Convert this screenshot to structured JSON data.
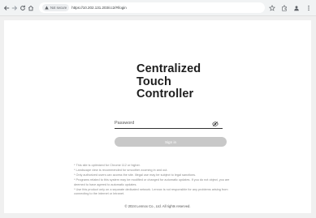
{
  "browser": {
    "security_label": "Not secure",
    "url": "https://10.202.131.203/cc2/#/login"
  },
  "login": {
    "title_lines": [
      "Centralized",
      "Touch",
      "Controller"
    ],
    "password_placeholder": "Password",
    "sign_in_label": "Sign in"
  },
  "notes": [
    "* This site is optimized for Chrome 112 or higher.",
    "* Landscape view is recommended for smoother zooming in and out.",
    "* Only authorized users can access the site. Illegal use may be subject to legal sanctions.",
    "* Programs related to this system may be modified or changed for automatic updates. If you do not object, you are",
    "  deemed to have agreed to automatic updates.",
    "* Use this product only on a separate dedicated network. Lennox is not responsible for any problems arising from",
    "  connecting to the internet or Intranet."
  ],
  "footer": {
    "copyright": "© 2024 Lennox Co., Ltd. All rights reserved."
  }
}
